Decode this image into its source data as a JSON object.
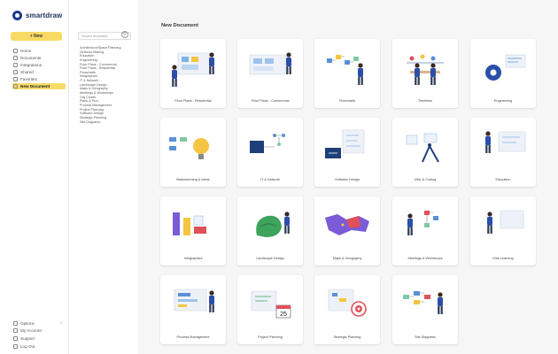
{
  "brand": {
    "name": "smartdraw"
  },
  "nav": {
    "new_label": "+ New",
    "items": [
      {
        "label": "Home",
        "icon": "home-icon"
      },
      {
        "label": "Documents",
        "icon": "folder-icon"
      },
      {
        "label": "Integrations",
        "icon": "grid-icon"
      },
      {
        "label": "Shared",
        "icon": "share-icon"
      },
      {
        "label": "Favorites",
        "icon": "star-icon"
      },
      {
        "label": "New Document",
        "icon": "document-icon",
        "active": true
      }
    ],
    "bottom": [
      {
        "label": "Options",
        "icon": "gear-icon",
        "chevron": "›"
      },
      {
        "label": "My Account",
        "icon": "user-icon"
      },
      {
        "label": "Support",
        "icon": "help-icon"
      },
      {
        "label": "Log Out",
        "icon": "logout-icon"
      }
    ]
  },
  "categories": {
    "search_placeholder": "Search templates",
    "items": [
      "Architecture/Space Planning",
      "Decision Making",
      "Education",
      "Engineering",
      "Floor Plans - Commercial",
      "Floor Plans - Residential",
      "Flowcharts",
      "Infographics",
      "IT & Network",
      "Landscape Design",
      "Maps & Geography",
      "Meetings & Workshops",
      "Org Charts",
      "Plans & Proc",
      "Process Management",
      "Project Planning",
      "Software Design",
      "Strategic Planning",
      "Site Diagrams"
    ]
  },
  "main": {
    "title": "New Document",
    "templates": [
      {
        "label": "Floor Plans - Residential"
      },
      {
        "label": "Floor Plans - Commercial"
      },
      {
        "label": "Flowcharts"
      },
      {
        "label": "Timelines"
      },
      {
        "label": "Engineering"
      },
      {
        "label": "Brainstorming & Ideas"
      },
      {
        "label": "IT & Network"
      },
      {
        "label": "Software Design"
      },
      {
        "label": "UML & Coding"
      },
      {
        "label": "Education"
      },
      {
        "label": "Infographics"
      },
      {
        "label": "Landscape Design"
      },
      {
        "label": "Maps & Geography"
      },
      {
        "label": "Meetings & Workshops"
      },
      {
        "label": "Kids Learning"
      },
      {
        "label": "Process Management"
      },
      {
        "label": "Project Planning"
      },
      {
        "label": "Strategic Planning"
      },
      {
        "label": "Site Diagrams"
      }
    ]
  },
  "colors": {
    "accent": "#f8da62",
    "brand": "#1b3a8c",
    "figure_blue": "#2b4fa8",
    "figure_skin": "#c98a5e"
  }
}
